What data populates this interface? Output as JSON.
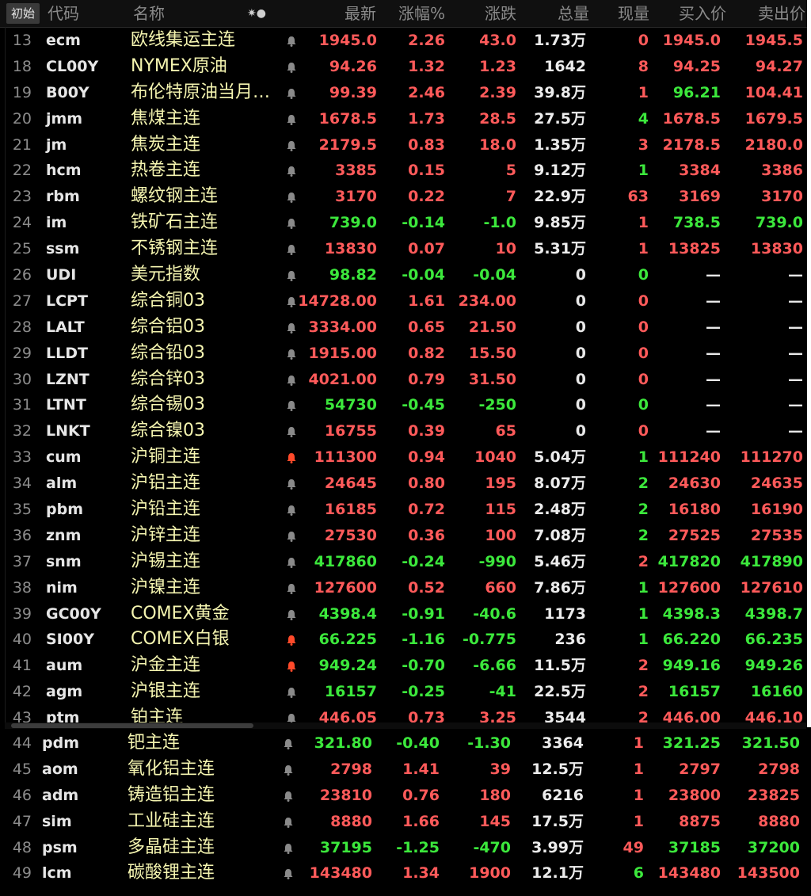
{
  "header": {
    "start_btn": "初始",
    "col_num": "代码",
    "col_name": "名称",
    "col_ctrl": "✷●",
    "col_last": "最新",
    "col_pct": "涨幅%",
    "col_chg": "涨跌",
    "col_vol": "总量",
    "col_curvol": "现量",
    "col_bid": "买入价",
    "col_ask": "卖出价"
  },
  "colors": {
    "up": "#ff5a5a",
    "down": "#3ce83c",
    "bell": "#8a8a8a",
    "bell_active": "#ff4a2a"
  },
  "rows": [
    {
      "idx": "13",
      "code": "ecm",
      "name": "欧线集运主连",
      "bell": "normal",
      "last": "1945.0",
      "pct": "2.26",
      "chg": "43.0",
      "vol": "1.73万",
      "cur": "0",
      "bid": "1945.0",
      "ask": "1945.5",
      "dir": "up",
      "curdir": "up"
    },
    {
      "idx": "18",
      "code": "CL00Y",
      "name": "NYMEX原油",
      "bell": "normal",
      "last": "94.26",
      "pct": "1.32",
      "chg": "1.23",
      "vol": "1642",
      "cur": "8",
      "bid": "94.25",
      "ask": "94.27",
      "dir": "up",
      "curdir": "up"
    },
    {
      "idx": "19",
      "code": "B00Y",
      "name": "布伦特原油当月连续",
      "bell": "normal",
      "last": "99.39",
      "pct": "2.46",
      "chg": "2.39",
      "vol": "39.8万",
      "cur": "1",
      "bid": "96.21",
      "ask": "104.41",
      "dir": "up",
      "curdir": "up",
      "biddir": "down"
    },
    {
      "idx": "20",
      "code": "jmm",
      "name": "焦煤主连",
      "bell": "normal",
      "last": "1678.5",
      "pct": "1.73",
      "chg": "28.5",
      "vol": "27.5万",
      "cur": "4",
      "bid": "1678.5",
      "ask": "1679.5",
      "dir": "up",
      "curdir": "down"
    },
    {
      "idx": "21",
      "code": "jm",
      "name": "焦炭主连",
      "bell": "normal",
      "last": "2179.5",
      "pct": "0.83",
      "chg": "18.0",
      "vol": "1.35万",
      "cur": "3",
      "bid": "2178.5",
      "ask": "2180.0",
      "dir": "up",
      "curdir": "up"
    },
    {
      "idx": "22",
      "code": "hcm",
      "name": "热卷主连",
      "bell": "normal",
      "last": "3385",
      "pct": "0.15",
      "chg": "5",
      "vol": "9.12万",
      "cur": "1",
      "bid": "3384",
      "ask": "3386",
      "dir": "up",
      "curdir": "down"
    },
    {
      "idx": "23",
      "code": "rbm",
      "name": "螺纹钢主连",
      "bell": "normal",
      "last": "3170",
      "pct": "0.22",
      "chg": "7",
      "vol": "22.9万",
      "cur": "63",
      "bid": "3169",
      "ask": "3170",
      "dir": "up",
      "curdir": "up"
    },
    {
      "idx": "24",
      "code": "im",
      "name": "铁矿石主连",
      "bell": "normal",
      "last": "739.0",
      "pct": "-0.14",
      "chg": "-1.0",
      "vol": "9.85万",
      "cur": "1",
      "bid": "738.5",
      "ask": "739.0",
      "dir": "down",
      "curdir": "up"
    },
    {
      "idx": "25",
      "code": "ssm",
      "name": "不锈钢主连",
      "bell": "normal",
      "last": "13830",
      "pct": "0.07",
      "chg": "10",
      "vol": "5.31万",
      "cur": "1",
      "bid": "13825",
      "ask": "13830",
      "dir": "up",
      "curdir": "up"
    },
    {
      "idx": "26",
      "code": "UDI",
      "name": "美元指数",
      "bell": "normal",
      "last": "98.82",
      "pct": "-0.04",
      "chg": "-0.04",
      "vol": "0",
      "cur": "0",
      "bid": "—",
      "ask": "—",
      "dir": "down",
      "curdir": "down",
      "noquote": true
    },
    {
      "idx": "27",
      "code": "LCPT",
      "name": "综合铜03",
      "bell": "normal",
      "last": "14728.00",
      "pct": "1.61",
      "chg": "234.00",
      "vol": "0",
      "cur": "0",
      "bid": "—",
      "ask": "—",
      "dir": "up",
      "curdir": "up",
      "noquote": true
    },
    {
      "idx": "28",
      "code": "LALT",
      "name": "综合铝03",
      "bell": "normal",
      "last": "3334.00",
      "pct": "0.65",
      "chg": "21.50",
      "vol": "0",
      "cur": "0",
      "bid": "—",
      "ask": "—",
      "dir": "up",
      "curdir": "up",
      "noquote": true
    },
    {
      "idx": "29",
      "code": "LLDT",
      "name": "综合铅03",
      "bell": "normal",
      "last": "1915.00",
      "pct": "0.82",
      "chg": "15.50",
      "vol": "0",
      "cur": "0",
      "bid": "—",
      "ask": "—",
      "dir": "up",
      "curdir": "up",
      "noquote": true
    },
    {
      "idx": "30",
      "code": "LZNT",
      "name": "综合锌03",
      "bell": "normal",
      "last": "4021.00",
      "pct": "0.79",
      "chg": "31.50",
      "vol": "0",
      "cur": "0",
      "bid": "—",
      "ask": "—",
      "dir": "up",
      "curdir": "up",
      "noquote": true
    },
    {
      "idx": "31",
      "code": "LTNT",
      "name": "综合锡03",
      "bell": "normal",
      "last": "54730",
      "pct": "-0.45",
      "chg": "-250",
      "vol": "0",
      "cur": "0",
      "bid": "—",
      "ask": "—",
      "dir": "down",
      "curdir": "down",
      "noquote": true
    },
    {
      "idx": "32",
      "code": "LNKT",
      "name": "综合镍03",
      "bell": "normal",
      "last": "16755",
      "pct": "0.39",
      "chg": "65",
      "vol": "0",
      "cur": "0",
      "bid": "—",
      "ask": "—",
      "dir": "up",
      "curdir": "up",
      "noquote": true
    },
    {
      "idx": "33",
      "code": "cum",
      "name": "沪铜主连",
      "bell": "active",
      "last": "111300",
      "pct": "0.94",
      "chg": "1040",
      "vol": "5.04万",
      "cur": "1",
      "bid": "111240",
      "ask": "111270",
      "dir": "up",
      "curdir": "down"
    },
    {
      "idx": "34",
      "code": "alm",
      "name": "沪铝主连",
      "bell": "normal",
      "last": "24645",
      "pct": "0.80",
      "chg": "195",
      "vol": "8.07万",
      "cur": "2",
      "bid": "24630",
      "ask": "24635",
      "dir": "up",
      "curdir": "down"
    },
    {
      "idx": "35",
      "code": "pbm",
      "name": "沪铅主连",
      "bell": "normal",
      "last": "16185",
      "pct": "0.72",
      "chg": "115",
      "vol": "2.48万",
      "cur": "2",
      "bid": "16180",
      "ask": "16190",
      "dir": "up",
      "curdir": "down"
    },
    {
      "idx": "36",
      "code": "znm",
      "name": "沪锌主连",
      "bell": "normal",
      "last": "27530",
      "pct": "0.36",
      "chg": "100",
      "vol": "7.08万",
      "cur": "2",
      "bid": "27525",
      "ask": "27535",
      "dir": "up",
      "curdir": "down"
    },
    {
      "idx": "37",
      "code": "snm",
      "name": "沪锡主连",
      "bell": "normal",
      "last": "417860",
      "pct": "-0.24",
      "chg": "-990",
      "vol": "5.46万",
      "cur": "2",
      "bid": "417820",
      "ask": "417890",
      "dir": "down",
      "curdir": "up"
    },
    {
      "idx": "38",
      "code": "nim",
      "name": "沪镍主连",
      "bell": "normal",
      "last": "127600",
      "pct": "0.52",
      "chg": "660",
      "vol": "7.86万",
      "cur": "1",
      "bid": "127600",
      "ask": "127610",
      "dir": "up",
      "curdir": "down"
    },
    {
      "idx": "39",
      "code": "GC00Y",
      "name": "COMEX黄金",
      "bell": "normal",
      "last": "4398.4",
      "pct": "-0.91",
      "chg": "-40.6",
      "vol": "1173",
      "cur": "1",
      "bid": "4398.3",
      "ask": "4398.7",
      "dir": "down",
      "curdir": "down"
    },
    {
      "idx": "40",
      "code": "SI00Y",
      "name": "COMEX白银",
      "bell": "active",
      "last": "66.225",
      "pct": "-1.16",
      "chg": "-0.775",
      "vol": "236",
      "cur": "1",
      "bid": "66.220",
      "ask": "66.235",
      "dir": "down",
      "curdir": "down"
    },
    {
      "idx": "41",
      "code": "aum",
      "name": "沪金主连",
      "bell": "active",
      "last": "949.24",
      "pct": "-0.70",
      "chg": "-6.66",
      "vol": "11.5万",
      "cur": "2",
      "bid": "949.16",
      "ask": "949.26",
      "dir": "down",
      "curdir": "up"
    },
    {
      "idx": "42",
      "code": "agm",
      "name": "沪银主连",
      "bell": "normal",
      "last": "16157",
      "pct": "-0.25",
      "chg": "-41",
      "vol": "22.5万",
      "cur": "2",
      "bid": "16157",
      "ask": "16160",
      "dir": "down",
      "curdir": "up"
    },
    {
      "idx": "43",
      "code": "ptm",
      "name": "铂主连",
      "bell": "normal",
      "last": "446.05",
      "pct": "0.73",
      "chg": "3.25",
      "vol": "3544",
      "cur": "2",
      "bid": "446.00",
      "ask": "446.10",
      "dir": "up",
      "curdir": "up"
    }
  ],
  "rows_bottom": [
    {
      "idx": "44",
      "code": "pdm",
      "name": "钯主连",
      "bell": "normal",
      "last": "321.80",
      "pct": "-0.40",
      "chg": "-1.30",
      "vol": "3364",
      "cur": "1",
      "bid": "321.25",
      "ask": "321.50",
      "dir": "down",
      "curdir": "up"
    },
    {
      "idx": "45",
      "code": "aom",
      "name": "氧化铝主连",
      "bell": "normal",
      "last": "2798",
      "pct": "1.41",
      "chg": "39",
      "vol": "12.5万",
      "cur": "1",
      "bid": "2797",
      "ask": "2798",
      "dir": "up",
      "curdir": "up"
    },
    {
      "idx": "46",
      "code": "adm",
      "name": "铸造铝主连",
      "bell": "normal",
      "last": "23810",
      "pct": "0.76",
      "chg": "180",
      "vol": "6216",
      "cur": "1",
      "bid": "23800",
      "ask": "23825",
      "dir": "up",
      "curdir": "up"
    },
    {
      "idx": "47",
      "code": "sim",
      "name": "工业硅主连",
      "bell": "normal",
      "last": "8880",
      "pct": "1.66",
      "chg": "145",
      "vol": "17.5万",
      "cur": "1",
      "bid": "8875",
      "ask": "8880",
      "dir": "up",
      "curdir": "up"
    },
    {
      "idx": "48",
      "code": "psm",
      "name": "多晶硅主连",
      "bell": "normal",
      "last": "37195",
      "pct": "-1.25",
      "chg": "-470",
      "vol": "3.99万",
      "cur": "49",
      "bid": "37185",
      "ask": "37200",
      "dir": "down",
      "curdir": "up"
    },
    {
      "idx": "49",
      "code": "lcm",
      "name": "碳酸锂主连",
      "bell": "normal",
      "last": "143480",
      "pct": "1.34",
      "chg": "1900",
      "vol": "12.1万",
      "cur": "6",
      "bid": "143480",
      "ask": "143500",
      "dir": "up",
      "curdir": "down"
    }
  ]
}
